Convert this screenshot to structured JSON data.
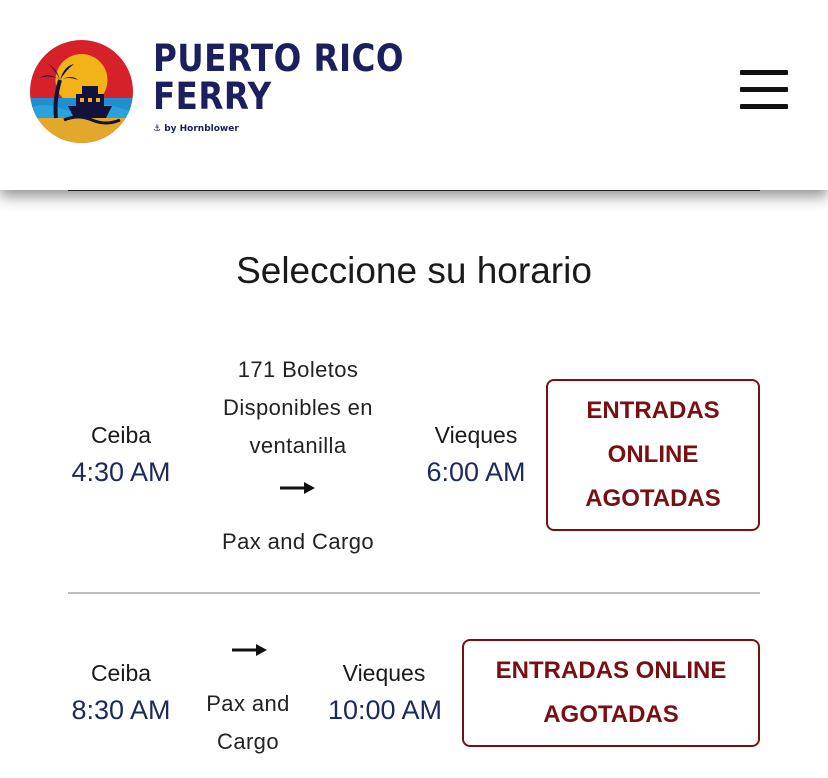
{
  "header": {
    "brand_line1": "PUERTO RICO",
    "brand_line2": "FERRY",
    "brand_sub": "⚓ by Hornblower",
    "menu_icon": "hamburger-menu-icon"
  },
  "page": {
    "title": "Seleccione su horario"
  },
  "schedules": [
    {
      "origin": "Ceiba",
      "depart_time": "4:30 AM",
      "availability_line1": "171 Boletos",
      "availability_line2": "Disponibles en",
      "availability_line3": "ventanilla",
      "arrow": "→",
      "type_label": "Pax and Cargo",
      "destination": "Vieques",
      "arrive_time": "6:00 AM",
      "status_line1": "ENTRADAS",
      "status_line2": "ONLINE",
      "status_line3": "AGOTADAS"
    },
    {
      "origin": "Ceiba",
      "depart_time": "8:30 AM",
      "arrow": "→",
      "type_label_line1": "Pax and",
      "type_label_line2": "Cargo",
      "destination": "Vieques",
      "arrive_time": "10:00 AM",
      "status_line1": "ENTRADAS ONLINE",
      "status_line2": "AGOTADAS"
    }
  ],
  "colors": {
    "brand_navy": "#1b1f5e",
    "time_blue": "#1b2a5e",
    "sold_out_red": "#7a0f12"
  }
}
